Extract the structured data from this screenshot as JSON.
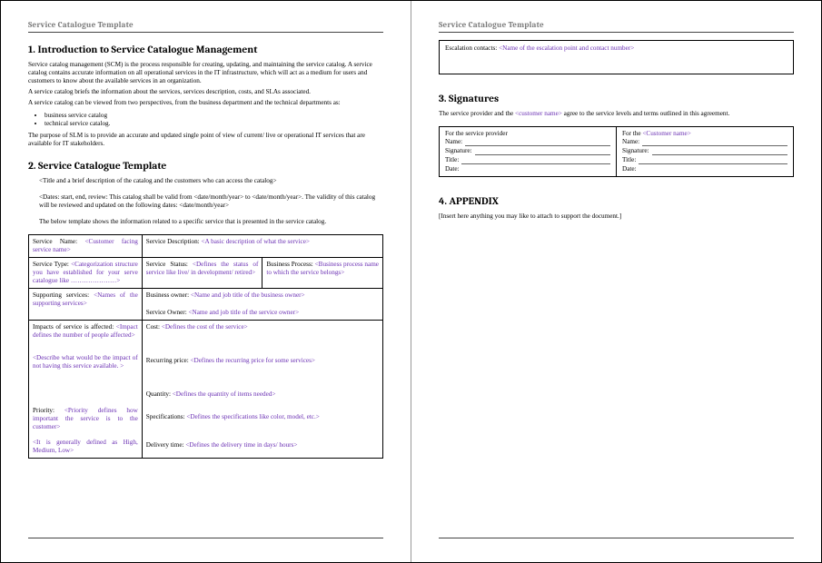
{
  "header": "Service Catalogue Template",
  "sec1": {
    "title": "1.  Introduction to Service Catalogue Management",
    "p1": "Service catalog management (SCM) is the process responsible for creating, updating, and maintaining the service catalog. A service catalog contains accurate information on all operational services in the IT infrastructure, which will act as a medium for users and customers to know about the available services in an organization.",
    "p2": "A service catalog briefs the information about the services, services description, costs, and SLAs associated.",
    "p3": "A service catalog can be viewed from two perspectives, from the business department and the technical departments as:",
    "bul1": "business service catalog",
    "bul2": "technical service catalog.",
    "p4": "The purpose of SLM is to provide an accurate and updated single point of view of current/ live or operational IT services that are available for IT stakeholders."
  },
  "sec2": {
    "title": "2.  Service Catalogue Template",
    "line1a": "<Title and a brief description of the catalog and the customers who can access the catalog>",
    "line2a": "<Dates: start, end, review: This catalog shall be valid from <date/month/year> to <date/month/year>. The validity of this catalog will be reviewed and updated on the following dates: <date/month/year>",
    "line3": "The below template shows the information related to a specific service that is presented in the service catalog."
  },
  "tbl": {
    "r1c1_l": "Service Name:",
    "r1c1_p": "<Customer facing service name>",
    "r1c2_l": "Service Description:",
    "r1c2_p": "<A basic description of what the service>",
    "r2c1_l": "Service Type:",
    "r2c1_p": "<Categorization structure you have established for your serve catalogue like …………………>",
    "r2c2_l": "Service Status:",
    "r2c2_p": "<Defines the status of service like live/ in development/ retired>",
    "r2c3_l": "Business Process:",
    "r2c3_p": "<Business process name to which the service belongs>",
    "r3c1_l": "Supporting services:",
    "r3c1_p": "<Names of the supporting services>",
    "r3c2a_l": "Business owner:",
    "r3c2a_p": "<Name and job title of the business owner>",
    "r3c2b_l": "Service Owner:",
    "r3c2b_p": "<Name and job title of the service owner>",
    "r4c1a_l": "Impacts of service is affected:",
    "r4c1a_p": "<Impact defines the number of people affected>",
    "r4c1b_p": "<Describe what would be the impact of not having this service available. >",
    "r4c1c_l": "Priority:",
    "r4c1c_p": "<Priority defines how important the service is to the customer>",
    "r4c1d_p": "<It is generally defined as High, Medium, Low>",
    "r4c2a_l": "Cost:",
    "r4c2a_p": "<Defines the cost of the service>",
    "r4c2b_l": "Recurring price:",
    "r4c2b_p": "<Defines the recurring price for some services>",
    "r4c2c_l": "Quantity:",
    "r4c2c_p": "<Defines the quantity of items needed>",
    "r4c2d_l": "Specifications:",
    "r4c2d_p": "<Defines the specifications like color, model, etc.>",
    "r4c2e_l": "Delivery time:",
    "r4c2e_p": "<Defines the delivery time in days/ hours>"
  },
  "esc": {
    "label": "Escalation contacts:",
    "ph": "<Name of the escalation point and contact number>"
  },
  "sec3": {
    "title": "3.  Signatures",
    "intro_a": "The service provider and the ",
    "intro_ph": "<customer name>",
    "intro_b": " agree to the service levels and terms outlined in this agreement."
  },
  "sig": {
    "leftHead": "For the service provider",
    "rightHead_a": "For the ",
    "rightHead_ph": "<Customer name>",
    "name": "Name:",
    "signature": "Signature:",
    "titleLbl": "Title:",
    "date": "Date:"
  },
  "sec4": {
    "title": "4.  APPENDIX",
    "body": "[Insert here anything you may like to attach to support the document.]"
  }
}
